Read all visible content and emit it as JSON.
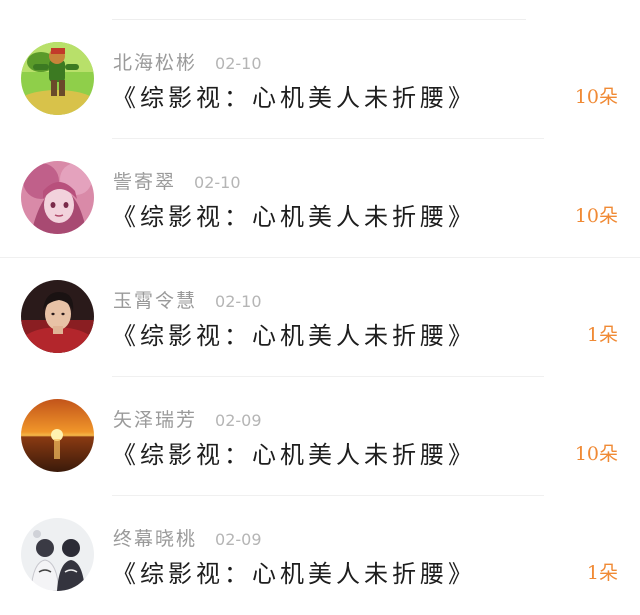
{
  "gift_list": {
    "items": [
      {
        "username": "北海松彬",
        "date": "02-10",
        "title": "《综影视：心机美人未折腰》",
        "gift": "10朵",
        "avatar_icon": "cartoon-character-avatar"
      },
      {
        "username": "訾寄翠",
        "date": "02-10",
        "title": "《综影视：心机美人未折腰》",
        "gift": "10朵",
        "avatar_icon": "anime-girl-avatar"
      },
      {
        "username": "玉霄令慧",
        "date": "02-10",
        "title": "《综影视：心机美人未折腰》",
        "gift": "1朵",
        "avatar_icon": "person-portrait-avatar"
      },
      {
        "username": "矢泽瑞芳",
        "date": "02-09",
        "title": "《综影视：心机美人未折腰》",
        "gift": "10朵",
        "avatar_icon": "sunset-avatar"
      },
      {
        "username": "终幕晓桃",
        "date": "02-09",
        "title": "《综影视：心机美人未折腰》",
        "gift": "1朵",
        "avatar_icon": "couple-photo-avatar"
      }
    ]
  },
  "colors": {
    "gift": "#f08a35",
    "username": "#9a9a9a",
    "date": "#b5b5b5",
    "title": "#1e1e1e",
    "divider": "#f0f0f0"
  }
}
